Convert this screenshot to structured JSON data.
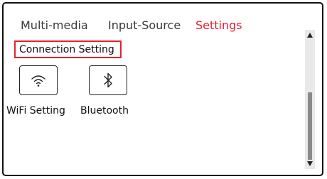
{
  "tabs": [
    {
      "label": "Multi-media",
      "active": false
    },
    {
      "label": "Input-Source",
      "active": false
    },
    {
      "label": "Settings",
      "active": true
    }
  ],
  "section": {
    "title": "Connection Setting"
  },
  "items": [
    {
      "label": "WiFi Setting",
      "icon": "wifi-icon"
    },
    {
      "label": "Bluetooth",
      "icon": "bluetooth-icon"
    }
  ],
  "colors": {
    "accent": "#e6202e",
    "text": "#111111",
    "tab_text": "#3a3a3a"
  }
}
